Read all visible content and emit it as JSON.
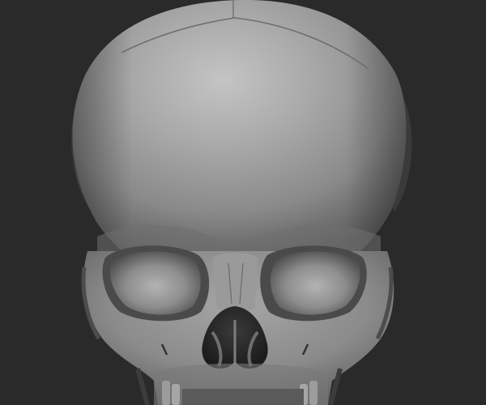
{
  "scene": {
    "subject": "sculpted-skull",
    "render_style": "matcap-clay",
    "colors": {
      "background": "#2a2a2a",
      "clay_light": "#b9b9b9",
      "clay_mid": "#8f8f8f",
      "clay_dark": "#4a4a4a",
      "cavity": "#1c1c1c"
    }
  }
}
